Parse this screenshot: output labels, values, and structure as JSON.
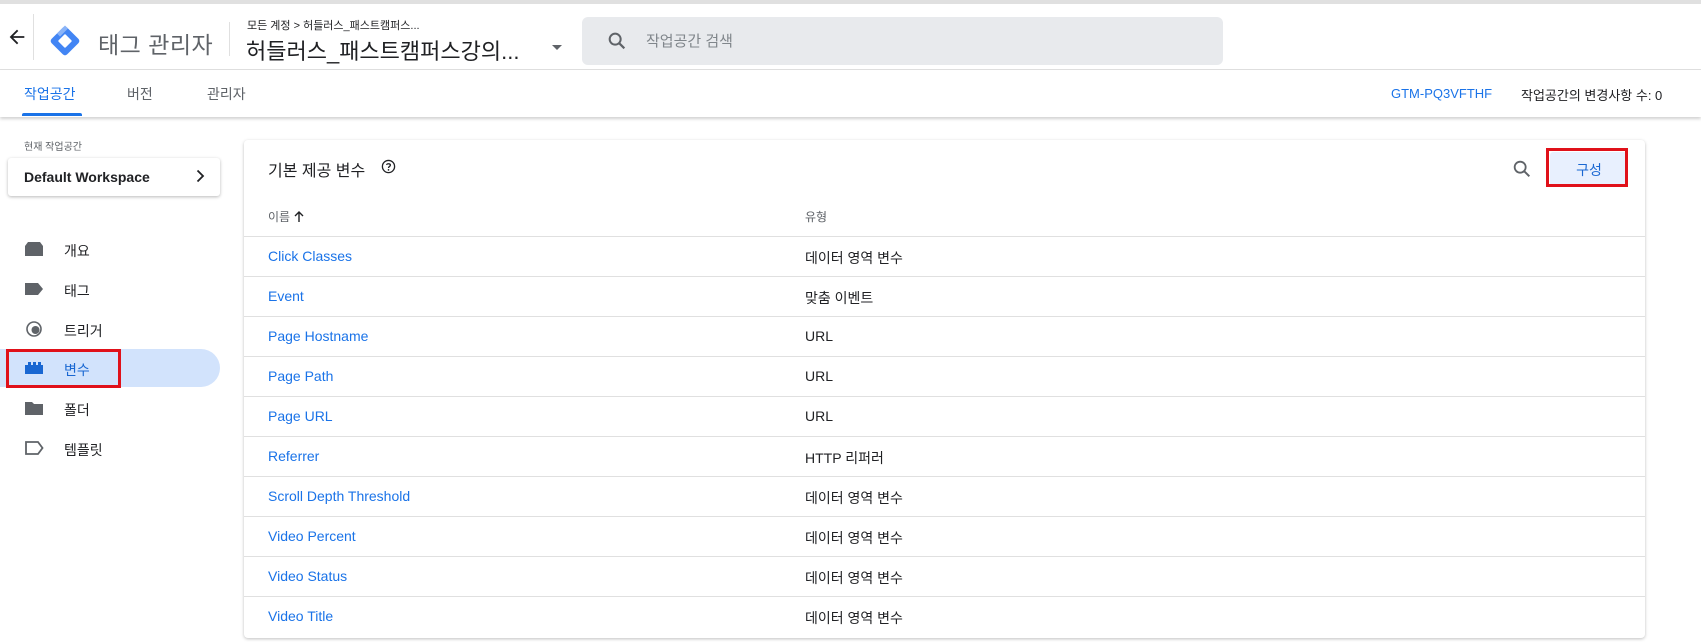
{
  "header": {
    "app_name": "태그 관리자",
    "breadcrumb": "모든 계정 > 허들러스_패스트캠퍼스...",
    "container_name": "허들러스_패스트캠퍼스강의...",
    "search_placeholder": "작업공간 검색"
  },
  "nav": {
    "tabs": [
      {
        "label": "작업공간",
        "active": true
      },
      {
        "label": "버전",
        "active": false
      },
      {
        "label": "관리자",
        "active": false
      }
    ],
    "container_id": "GTM-PQ3VFTHF",
    "changes_text": "작업공간의 변경사항 수: 0"
  },
  "sidebar": {
    "workspace_label": "현재 작업공간",
    "workspace_name": "Default Workspace",
    "items": [
      {
        "label": "개요",
        "icon": "overview-icon"
      },
      {
        "label": "태그",
        "icon": "tag-icon"
      },
      {
        "label": "트리거",
        "icon": "trigger-icon"
      },
      {
        "label": "변수",
        "icon": "variables-icon",
        "active": true
      },
      {
        "label": "폴더",
        "icon": "folder-icon"
      },
      {
        "label": "템플릿",
        "icon": "template-icon"
      }
    ]
  },
  "main": {
    "title": "기본 제공 변수",
    "configure_label": "구성",
    "columns": {
      "name": "이름",
      "type": "유형"
    },
    "rows": [
      {
        "name": "Click Classes",
        "type": "데이터 영역 변수"
      },
      {
        "name": "Event",
        "type": "맞춤 이벤트"
      },
      {
        "name": "Page Hostname",
        "type": "URL"
      },
      {
        "name": "Page Path",
        "type": "URL"
      },
      {
        "name": "Page URL",
        "type": "URL"
      },
      {
        "name": "Referrer",
        "type": "HTTP 리퍼러"
      },
      {
        "name": "Scroll Depth Threshold",
        "type": "데이터 영역 변수"
      },
      {
        "name": "Video Percent",
        "type": "데이터 영역 변수"
      },
      {
        "name": "Video Status",
        "type": "데이터 영역 변수"
      },
      {
        "name": "Video Title",
        "type": "데이터 영역 변수"
      }
    ]
  },
  "colors": {
    "accent": "#1a73e8",
    "active_nav_bg": "#d2e3fc",
    "highlight_red": "#e0111a"
  }
}
